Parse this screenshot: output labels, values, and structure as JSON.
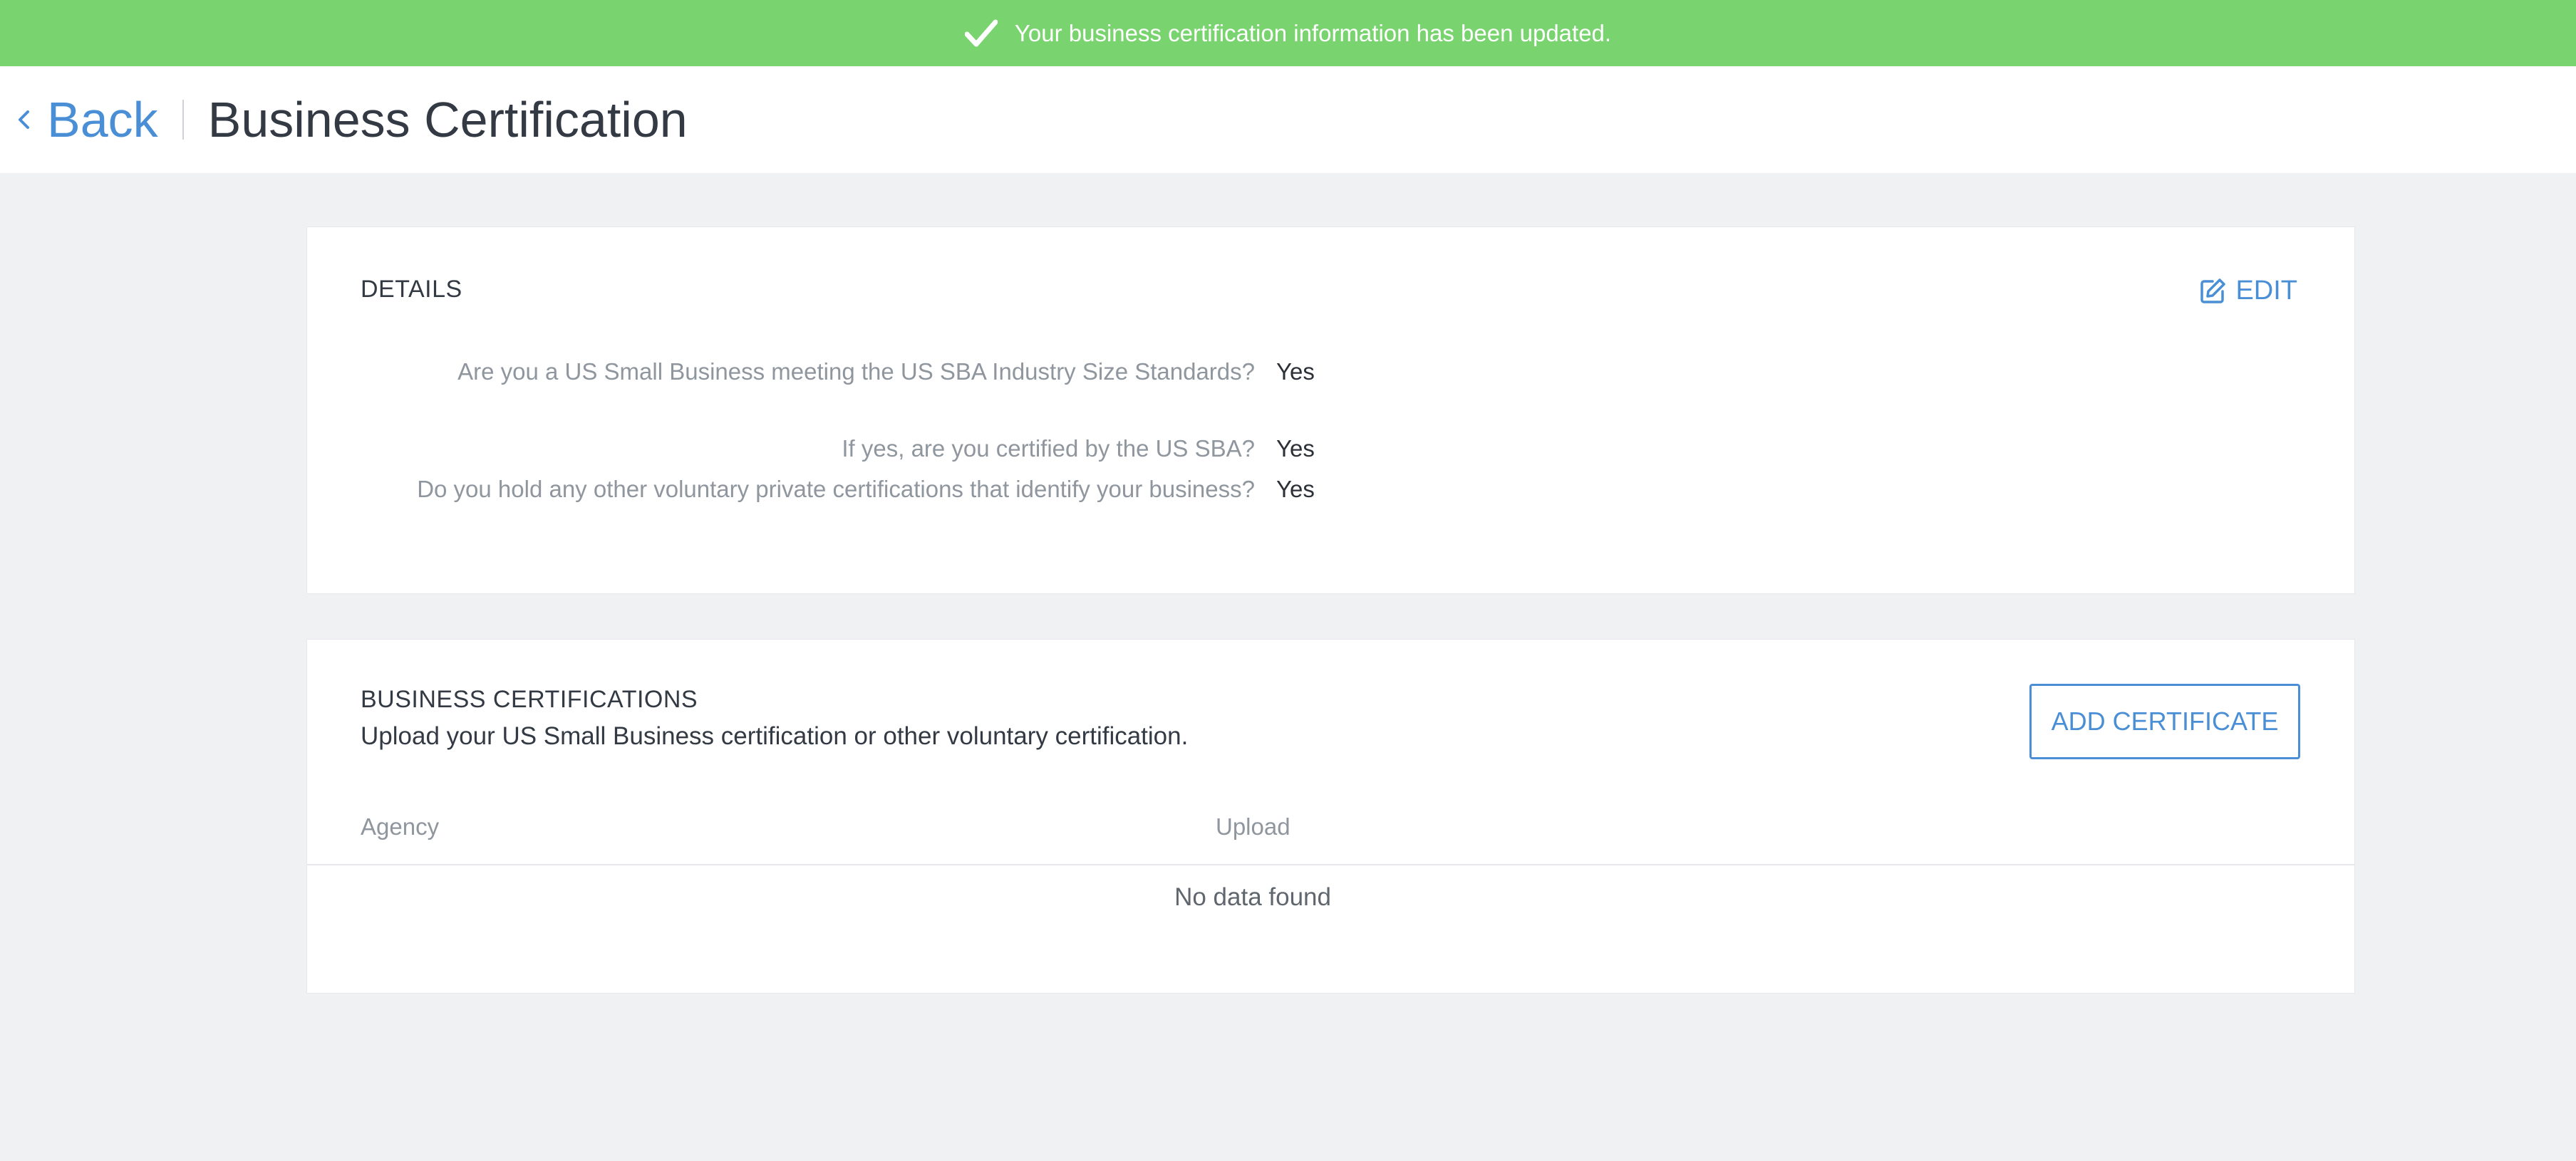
{
  "banner": {
    "message": "Your business certification information has been updated.",
    "icon": "check-icon",
    "color": "#79d46f"
  },
  "header": {
    "back_label": "Back",
    "title": "Business Certification"
  },
  "details": {
    "title": "DETAILS",
    "edit_label": "EDIT",
    "questions": [
      {
        "q": "Are you a US Small Business meeting the US SBA Industry Size Standards?",
        "a": "Yes"
      },
      {
        "q": "If yes, are you certified by the US SBA?",
        "a": "Yes"
      },
      {
        "q": "Do you hold any other voluntary private certifications that identify your business?",
        "a": "Yes"
      }
    ]
  },
  "certifications": {
    "title": "BUSINESS CERTIFICATIONS",
    "subtitle": "Upload your US Small Business certification or other voluntary certification.",
    "add_label": "ADD CERTIFICATE",
    "columns": [
      "Agency",
      "Upload"
    ],
    "empty_text": "No data found"
  },
  "colors": {
    "accent": "#4a8fd6",
    "background": "#f0f1f3"
  }
}
